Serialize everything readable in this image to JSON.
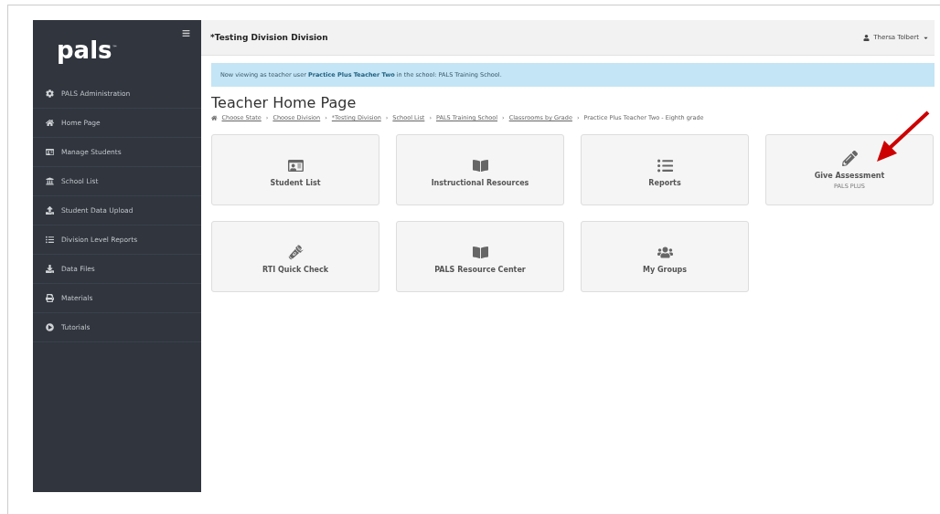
{
  "sidebar": {
    "logo": "pals",
    "trademark": "™",
    "items": [
      {
        "label": "PALS Administration",
        "kind": "gear"
      },
      {
        "label": "Home Page",
        "kind": "home"
      },
      {
        "label": "Manage Students",
        "kind": "idcard"
      },
      {
        "label": "School List",
        "kind": "bank"
      },
      {
        "label": "Student Data Upload",
        "kind": "upload"
      },
      {
        "label": "Division Level Reports",
        "kind": "list"
      },
      {
        "label": "Data Files",
        "kind": "download"
      },
      {
        "label": "Materials",
        "kind": "print"
      },
      {
        "label": "Tutorials",
        "kind": "play"
      }
    ]
  },
  "topbar": {
    "title": "*Testing Division Division",
    "user": "Thersa Tolbert"
  },
  "alert": "Now viewing as teacher user **Practice Plus Teacher Two** in the school: PALS Training School.",
  "page_title": "Teacher Home Page",
  "breadcrumb_separator": "›",
  "breadcrumb": [
    {
      "label": "Choose State",
      "link": true
    },
    {
      "label": "Choose Division",
      "link": true
    },
    {
      "label": "*Testing Division",
      "link": true
    },
    {
      "label": "School List",
      "link": true
    },
    {
      "label": "PALS Training School",
      "link": true
    },
    {
      "label": "Classrooms by Grade",
      "link": true
    },
    {
      "label": "Practice Plus Teacher Two - Eighth grade",
      "link": false
    }
  ],
  "tiles": [
    {
      "label": "Student List",
      "kind": "idcard"
    },
    {
      "label": "Instructional Resources",
      "kind": "book"
    },
    {
      "label": "Reports",
      "kind": "list"
    },
    {
      "label": "Give Assessment",
      "kind": "pencil",
      "subtitle": "PALS PLUS"
    },
    {
      "label": "RTI Quick Check",
      "kind": "flashlight"
    },
    {
      "label": "PALS Resource Center",
      "kind": "book"
    },
    {
      "label": "My Groups",
      "kind": "users"
    }
  ]
}
